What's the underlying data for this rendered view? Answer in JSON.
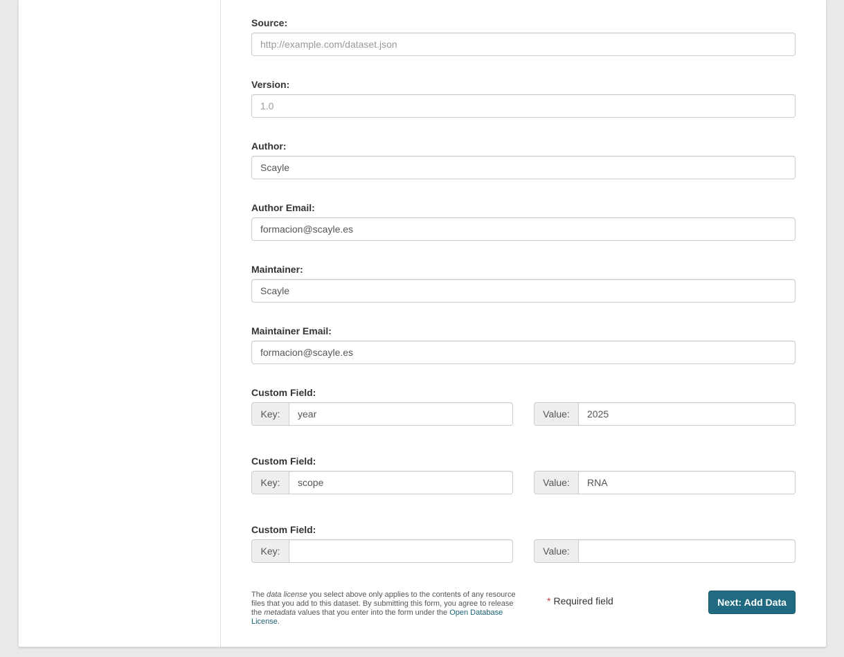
{
  "fields": {
    "source": {
      "label": "Source:",
      "value": "",
      "placeholder": "http://example.com/dataset.json"
    },
    "version": {
      "label": "Version:",
      "value": "",
      "placeholder": "1.0"
    },
    "author": {
      "label": "Author:",
      "value": "Scayle"
    },
    "author_email": {
      "label": "Author Email:",
      "value": "formacion@scayle.es"
    },
    "maintainer": {
      "label": "Maintainer:",
      "value": "Scayle"
    },
    "maintainer_email": {
      "label": "Maintainer Email:",
      "value": "formacion@scayle.es"
    }
  },
  "custom_fields": [
    {
      "label": "Custom Field:",
      "key_label": "Key:",
      "key": "year",
      "value_label": "Value:",
      "value": "2025"
    },
    {
      "label": "Custom Field:",
      "key_label": "Key:",
      "key": "scope",
      "value_label": "Value:",
      "value": "RNA"
    },
    {
      "label": "Custom Field:",
      "key_label": "Key:",
      "key": "",
      "value_label": "Value:",
      "value": ""
    }
  ],
  "footer": {
    "legal_1": "The ",
    "legal_em1": "data license",
    "legal_2": " you select above only applies to the contents of any resource files that you add to this dataset. By submitting this form, you agree to release the ",
    "legal_em2": "metadata",
    "legal_3": " values that you enter into the form under the ",
    "legal_link": "Open Database License",
    "legal_4": ".",
    "required_star": "*",
    "required_text": "Required field",
    "next_button": "Next: Add Data"
  },
  "colors": {
    "primary_button": "#206b82",
    "link": "#1b6173",
    "required_star": "#c6383a"
  }
}
